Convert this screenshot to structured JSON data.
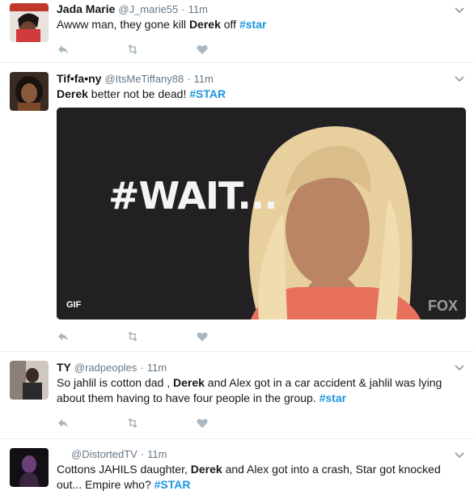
{
  "tweets": [
    {
      "name": "Jada Marie",
      "handle": "@J_marie55",
      "sep": "·",
      "time": "11m",
      "text": {
        "t1": "Awww man, they gone kill ",
        "b1": "Derek",
        "t2": " off ",
        "tag": "#star"
      }
    },
    {
      "name": "Tif•fa•ny",
      "handle": "@ItsMeTiffany88",
      "sep": "·",
      "time": "11m",
      "text": {
        "b1": "Derek",
        "t1": " better not be dead! ",
        "tag": "#STAR"
      },
      "media": {
        "overlay_text": "#WAIT...",
        "badge": "GIF",
        "watermark": "FOX"
      }
    },
    {
      "name": "TY",
      "handle": "@radpeoples",
      "sep": "·",
      "time": "11m",
      "text": {
        "t1": "So jahlil is cotton dad , ",
        "b1": "Derek",
        "t2": " and Alex got in a car accident & jahlil was lying about them having to have four people in the group.  ",
        "tag": "#star"
      }
    },
    {
      "name": "",
      "handle": "@DistortedTV",
      "sep": "·",
      "time": "11m",
      "text": {
        "t1": "Cottons JAHILS daughter, ",
        "b1": "Derek",
        "t2": " and Alex got into a crash, Star got knocked out... Empire who? ",
        "tag": "#STAR"
      }
    }
  ],
  "icons": {
    "reply": "reply-icon",
    "retweet": "retweet-icon",
    "like": "heart-icon",
    "more": "chevron-down-icon"
  },
  "colors": {
    "link": "#1b95e0",
    "muted": "#657786",
    "icon": "#aab8c2"
  }
}
